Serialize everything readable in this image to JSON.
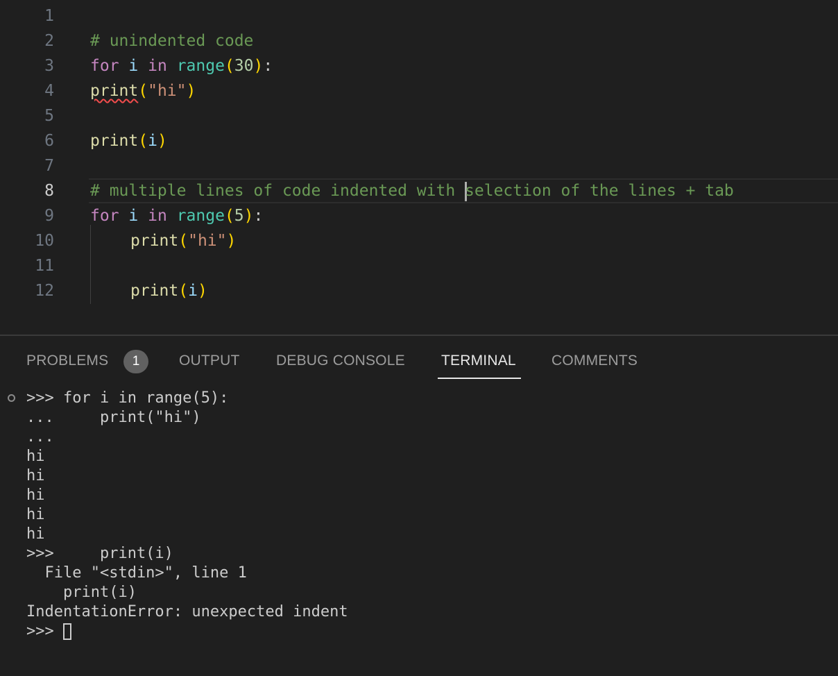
{
  "editor": {
    "line_numbers": [
      "1",
      "2",
      "3",
      "4",
      "5",
      "6",
      "7",
      "8",
      "9",
      "10",
      "11",
      "12"
    ],
    "current_line": "8",
    "lines": {
      "l2": {
        "comment": "# unindented code"
      },
      "l3": {
        "kw1": "for",
        "var": "i",
        "kw2": "in",
        "fn": "range",
        "open": "(",
        "num": "30",
        "close": ")",
        "colon": ":"
      },
      "l4": {
        "fn": "print",
        "open": "(",
        "str": "\"hi\"",
        "close": ")"
      },
      "l6": {
        "fn": "print",
        "open": "(",
        "var": "i",
        "close": ")"
      },
      "l8": {
        "comment_before": "# multiple lines of code indented with ",
        "comment_after": "selection of the lines + tab"
      },
      "l9": {
        "kw1": "for",
        "var": "i",
        "kw2": "in",
        "fn": "range",
        "open": "(",
        "num": "5",
        "close": ")",
        "colon": ":"
      },
      "l10": {
        "fn": "print",
        "open": "(",
        "str": "\"hi\"",
        "close": ")"
      },
      "l12": {
        "fn": "print",
        "open": "(",
        "var": "i",
        "close": ")"
      }
    }
  },
  "panel": {
    "tabs": [
      {
        "label": "PROBLEMS",
        "badge": "1"
      },
      {
        "label": "OUTPUT"
      },
      {
        "label": "DEBUG CONSOLE"
      },
      {
        "label": "TERMINAL",
        "active": true
      },
      {
        "label": "COMMENTS"
      }
    ],
    "terminal_lines": [
      ">>> for i in range(5):",
      "...     print(\"hi\")",
      "...",
      "hi",
      "hi",
      "hi",
      "hi",
      "hi",
      ">>>     print(i)",
      "  File \"<stdin>\", line 1",
      "    print(i)",
      "IndentationError: unexpected indent",
      ">>> "
    ]
  },
  "colors": {
    "background": "#1f1f1f",
    "keyword": "#c586c0",
    "variable": "#9cdcfe",
    "builtin": "#4ec9b0",
    "function": "#dcdcaa",
    "number": "#b5cea8",
    "string": "#ce9178",
    "bracket": "#ffd700",
    "comment": "#6a9955",
    "error_squiggle": "#f14c4c"
  }
}
